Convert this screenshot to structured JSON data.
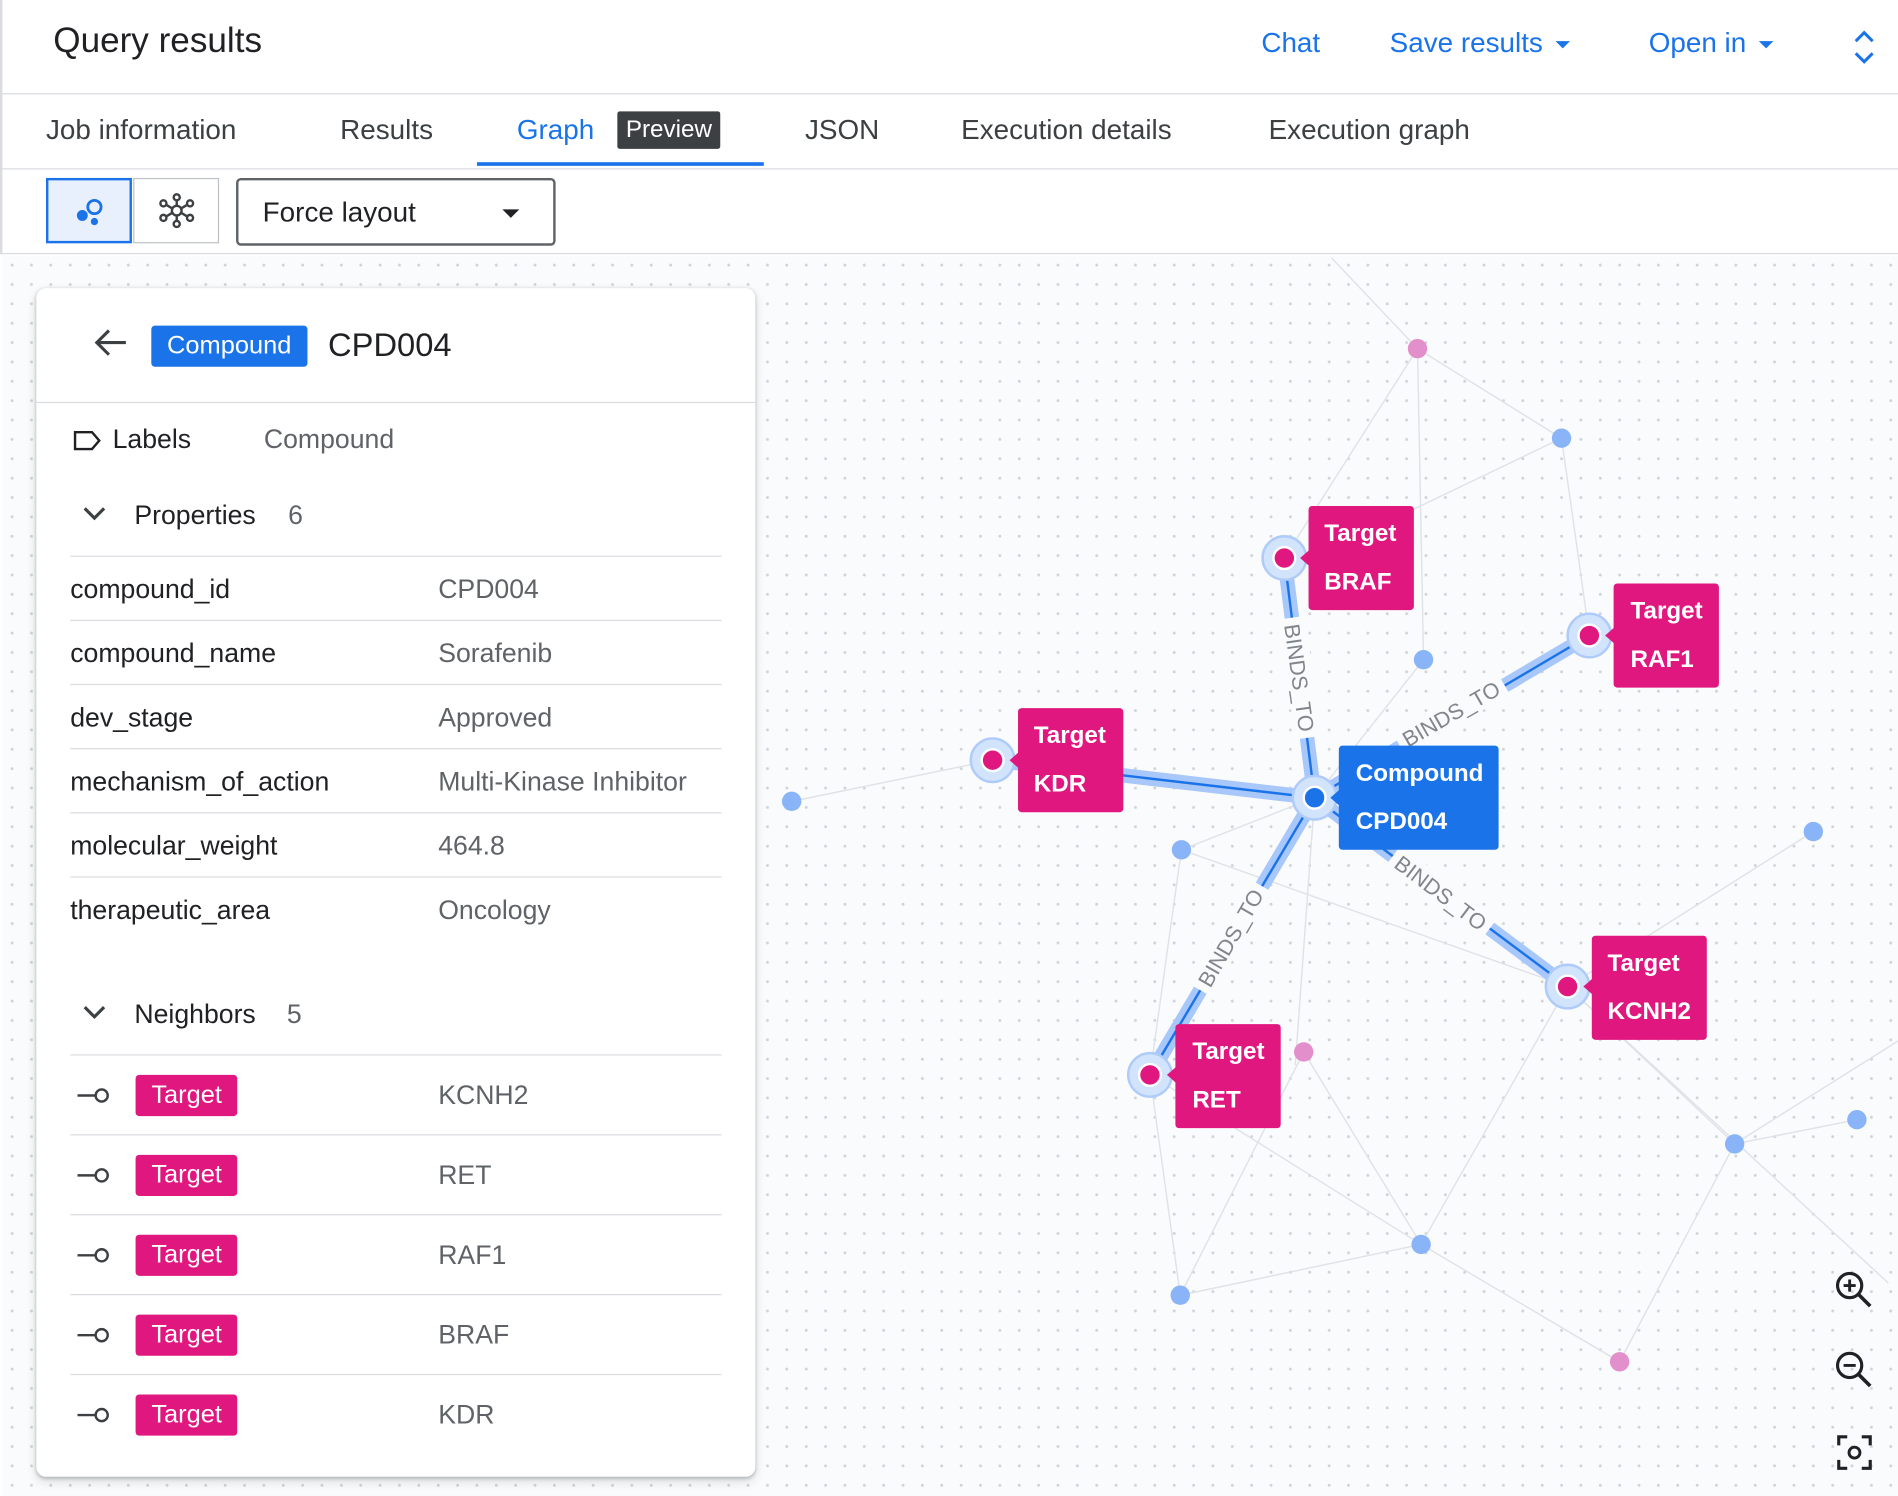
{
  "header": {
    "title": "Query results",
    "chat_label": "Chat",
    "save_label": "Save results",
    "open_label": "Open in"
  },
  "tabs": [
    {
      "label": "Job information"
    },
    {
      "label": "Results"
    },
    {
      "label": "Graph",
      "badge": "Preview"
    },
    {
      "label": "JSON"
    },
    {
      "label": "Execution details"
    },
    {
      "label": "Execution graph"
    }
  ],
  "toolbar": {
    "layout_value": "Force layout"
  },
  "panel": {
    "chip": "Compound",
    "title": "CPD004",
    "labels_key": "Labels",
    "labels_value": "Compound",
    "properties_label": "Properties",
    "properties_count": "6",
    "properties": [
      {
        "key": "compound_id",
        "value": "CPD004"
      },
      {
        "key": "compound_name",
        "value": "Sorafenib"
      },
      {
        "key": "dev_stage",
        "value": "Approved"
      },
      {
        "key": "mechanism_of_action",
        "value": "Multi-Kinase Inhibitor"
      },
      {
        "key": "molecular_weight",
        "value": "464.8"
      },
      {
        "key": "therapeutic_area",
        "value": "Oncology"
      }
    ],
    "neighbors_label": "Neighbors",
    "neighbors_count": "5",
    "neighbors": [
      {
        "chip": "Target",
        "value": "KCNH2"
      },
      {
        "chip": "Target",
        "value": "RET"
      },
      {
        "chip": "Target",
        "value": "RAF1"
      },
      {
        "chip": "Target",
        "value": "BRAF"
      },
      {
        "chip": "Target",
        "value": "KDR"
      }
    ]
  },
  "graph": {
    "edge_label": "BINDS_TO",
    "center": {
      "type": "Compound",
      "name": "CPD004"
    },
    "targets": [
      {
        "type": "Target",
        "name": "BRAF"
      },
      {
        "type": "Target",
        "name": "RAF1"
      },
      {
        "type": "Target",
        "name": "KDR"
      },
      {
        "type": "Target",
        "name": "KCNH2"
      },
      {
        "type": "Target",
        "name": "RET"
      }
    ],
    "colors": {
      "compound": "#1a73e8",
      "target": "#e0177f",
      "edge_highlight": "#a8c7fa"
    }
  },
  "icons": {
    "back": "arrow-back-icon",
    "label": "label-icon",
    "zoom_in": "zoom-in-icon",
    "zoom_out": "zoom-out-icon",
    "fit": "fit-screen-icon",
    "view_bubbles": "bubble-view-icon",
    "view_network": "network-view-icon",
    "expand": "unfold-icon"
  }
}
